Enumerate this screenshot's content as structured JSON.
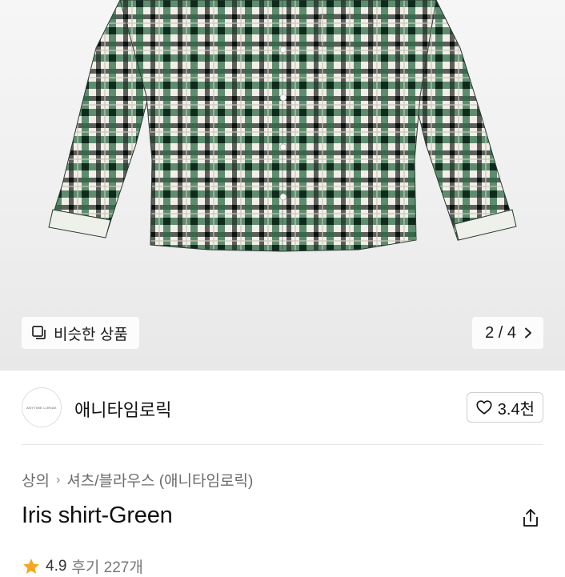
{
  "product": {
    "similar_label": "비슷한 상품",
    "page_indicator": "2 / 4",
    "title": "Iris shirt-Green"
  },
  "brand": {
    "name": "애니타임로릭",
    "logo_text": "ANYTIME LORIAK",
    "likes": "3.4천"
  },
  "breadcrumb": {
    "category": "상의",
    "subcategory": "셔츠/블라우스 (애니타임로릭)"
  },
  "rating": {
    "score": "4.9",
    "reviews": "후기 227개"
  },
  "colors": {
    "plaid_green": "#1f5a3c",
    "plaid_dark": "#1b2420",
    "plaid_light": "#f2efe8",
    "star": "#f5a623"
  },
  "icons": {
    "similar": "similar-products-icon",
    "chevron": "chevron-right-icon",
    "heart": "heart-icon",
    "share": "share-icon",
    "star": "star-icon"
  }
}
